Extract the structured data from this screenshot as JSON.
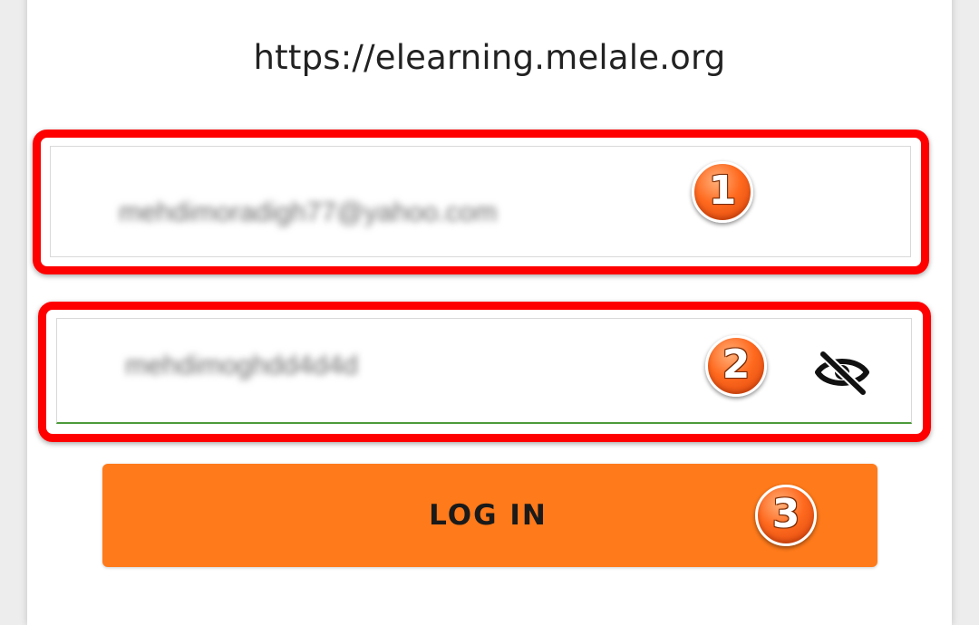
{
  "site": {
    "url": "https://elearning.melale.org"
  },
  "login_form": {
    "email_value": "mehdimoradigh77@yahoo.com",
    "password_value": "mehdimoghdd4d4d",
    "password_toggle_icon": "eye-off-icon",
    "login_label": "LOG IN"
  },
  "annotations": {
    "step_1": "1",
    "step_2": "2",
    "step_3": "3",
    "highlight_color": "#ff0000",
    "badge_color": "#ff6a1f"
  },
  "colors": {
    "button_background": "#ff7a1a",
    "focus_underline": "#4c9a3a"
  }
}
